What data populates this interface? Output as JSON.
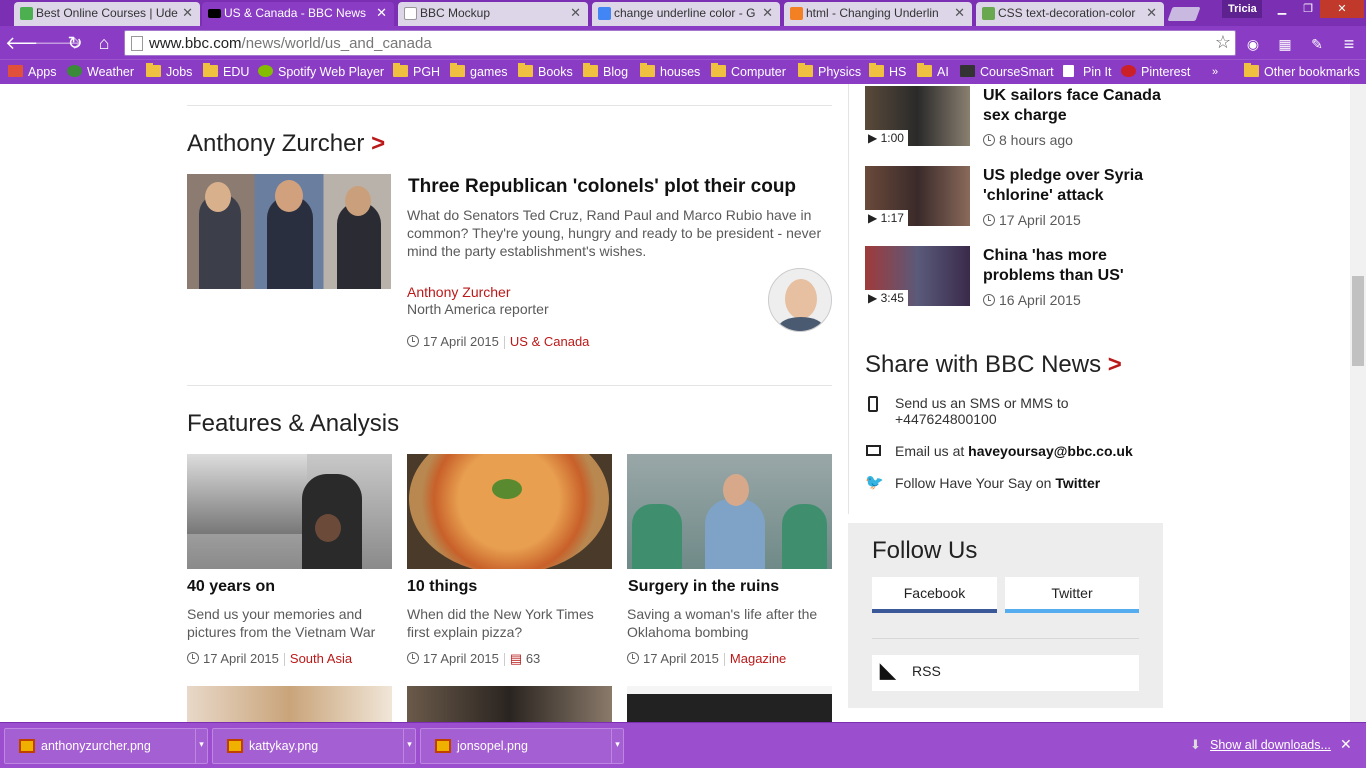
{
  "browser": {
    "tabs": [
      {
        "label": "Best Online Courses | Ude",
        "fav_color": "#4caf50"
      },
      {
        "label": "US & Canada - BBC News",
        "fav_color": "#000000",
        "active": true
      },
      {
        "label": "BBC Mockup",
        "fav_color": "#ffffff"
      },
      {
        "label": "change underline color - G",
        "fav_color": "#4285f4"
      },
      {
        "label": "html - Changing Underlin",
        "fav_color": "#f48024"
      },
      {
        "label": "CSS text-decoration-color",
        "fav_color": "#6aa84f"
      }
    ],
    "user": "Tricia",
    "url_host": "www.bbc.com",
    "url_path": "/news/world/us_and_canada",
    "bookmarks": [
      "Apps",
      "Weather",
      "Jobs",
      "EDU",
      "Spotify Web Player",
      "PGH",
      "games",
      "Books",
      "Blog",
      "houses",
      "Computer",
      "Physics",
      "HS",
      "AI",
      "CourseSmart",
      "Pin It",
      "Pinterest"
    ],
    "other_bookmarks": "Other bookmarks",
    "overflow": "»"
  },
  "main": {
    "author_section": {
      "heading": "Anthony Zurcher",
      "headline": "Three Republican 'colonels' plot their coup",
      "summary": "What do Senators Ted Cruz, Rand Paul and Marco Rubio have in common? They're young, hungry and ready to be president - never mind the party establishment's wishes.",
      "author_name": "Anthony Zurcher",
      "author_role": "North America reporter",
      "date": "17 April 2015",
      "tag": "US & Canada"
    },
    "features": {
      "heading": "Features & Analysis",
      "items": [
        {
          "title": "40 years on",
          "summary": "Send us your memories and pictures from the Vietnam War",
          "date": "17 April 2015",
          "tag": "South Asia"
        },
        {
          "title": "10 things",
          "summary": "When did the New York Times first explain pizza?",
          "date": "17 April 2015",
          "comments": "63"
        },
        {
          "title": "Surgery in the ruins",
          "summary": "Saving a woman's life after the Oklahoma bombing",
          "date": "17 April 2015",
          "tag": "Magazine"
        }
      ]
    }
  },
  "sidebar": {
    "videos": [
      {
        "title": "UK sailors face Canada sex charge",
        "duration": "1:00",
        "time": "8 hours ago"
      },
      {
        "title": "US pledge over Syria 'chlorine' attack",
        "duration": "1:17",
        "time": "17 April 2015"
      },
      {
        "title": "China 'has more problems than US'",
        "duration": "3:45",
        "time": "16 April 2015"
      }
    ],
    "share": {
      "heading": "Share with BBC News",
      "sms": "Send us an SMS or MMS to +447624800100",
      "email_prefix": "Email us at",
      "email": "haveyoursay@bbc.co.uk",
      "twitter_prefix": "Follow Have Your Say on",
      "twitter": "Twitter"
    },
    "follow": {
      "heading": "Follow Us",
      "facebook": "Facebook",
      "twitter": "Twitter",
      "rss": "RSS"
    }
  },
  "downloads": {
    "files": [
      "anthonyzurcher.png",
      "kattykay.png",
      "jonsopel.png"
    ],
    "show_all": "Show all downloads..."
  }
}
